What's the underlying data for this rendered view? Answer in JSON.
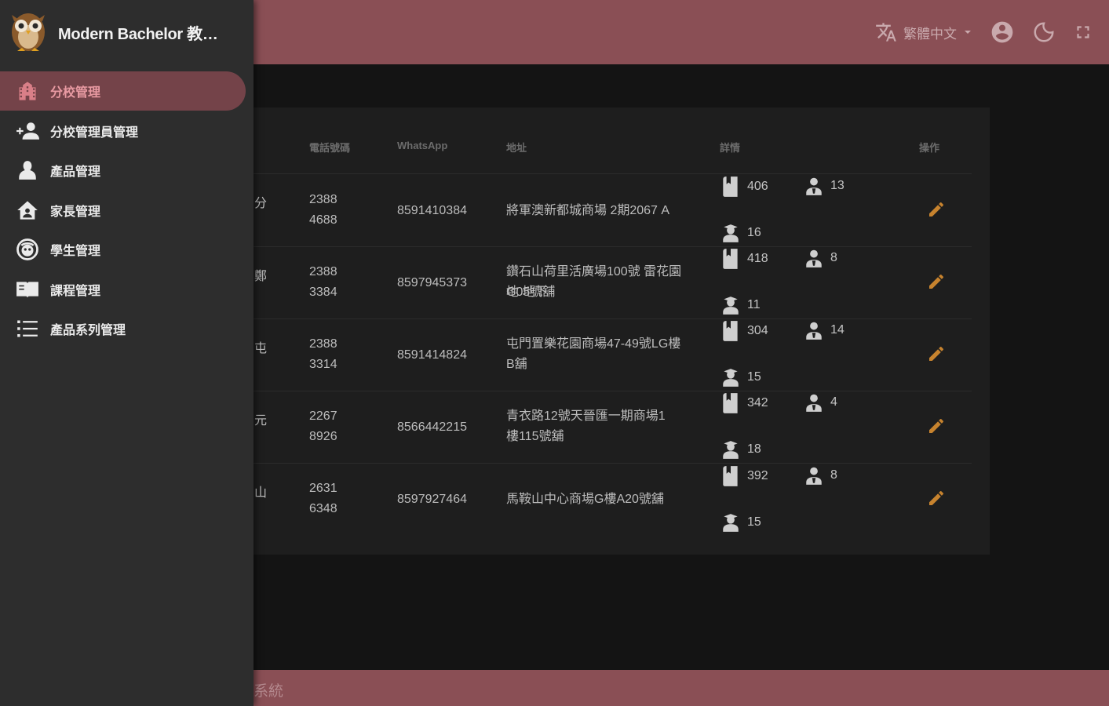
{
  "app": {
    "title": "Modern Bachelor 教育...",
    "footer_text": "系統"
  },
  "header": {
    "language": "繁體中文",
    "icons": [
      "translate-icon",
      "account-icon",
      "dark-mode-icon",
      "fullscreen-icon"
    ]
  },
  "sidebar": {
    "items": [
      {
        "label": "分校管理",
        "icon": "school-icon",
        "active": true
      },
      {
        "label": "分校管理員管理",
        "icon": "admin-group-icon",
        "active": false
      },
      {
        "label": "產品管理",
        "icon": "person-icon",
        "active": false
      },
      {
        "label": "家長管理",
        "icon": "home-icon",
        "active": false
      },
      {
        "label": "學生管理",
        "icon": "face-icon",
        "active": false
      },
      {
        "label": "課程管理",
        "icon": "book-icon",
        "active": false
      },
      {
        "label": "產品系列管理",
        "icon": "list-icon",
        "active": false
      }
    ]
  },
  "table": {
    "headers": {
      "phone": "電話號碼",
      "whatsapp": "WhatsApp",
      "address": "地址",
      "details": "詳情",
      "actions": "操作"
    },
    "rows": [
      {
        "name_frag": "分",
        "phone1": "2388",
        "phone2": "4688",
        "whatsapp": "8591410384",
        "addr1": "將軍澳新都城商場 2期2067 A",
        "addr2": "",
        "books": "406",
        "teachers": "13",
        "students": "16"
      },
      {
        "name_frag": "鄭",
        "phone1": "2388",
        "phone2": "3384",
        "whatsapp": "8597945373",
        "addr1": "鑽石山荷里活廣場100號 雷花園地 地下",
        "addr2": "G05號舖",
        "books": "418",
        "teachers": "8",
        "students": "11"
      },
      {
        "name_frag": "屯",
        "phone1": "2388",
        "phone2": "3314",
        "whatsapp": "8591414824",
        "addr1": "屯門置樂花園商場47-49號LG樓",
        "addr2": "B舖",
        "books": "304",
        "teachers": "14",
        "students": "15"
      },
      {
        "name_frag": "元",
        "phone1": "2267",
        "phone2": "8926",
        "whatsapp": "8566442215",
        "addr1": "青衣路12號天晉匯一期商場1",
        "addr2": "樓115號舖",
        "books": "342",
        "teachers": "4",
        "students": "18"
      },
      {
        "name_frag": "山",
        "phone1": "2631",
        "phone2": "6348",
        "whatsapp": "8597927464",
        "addr1": "馬鞍山中心商場G樓A20號舖",
        "addr2": "",
        "books": "392",
        "teachers": "8",
        "students": "15"
      }
    ]
  },
  "colors": {
    "accent": "#8a4f55",
    "active_nav_bg": "#744349",
    "active_nav_text": "#e89aa2",
    "edit_icon": "#c7832e"
  }
}
